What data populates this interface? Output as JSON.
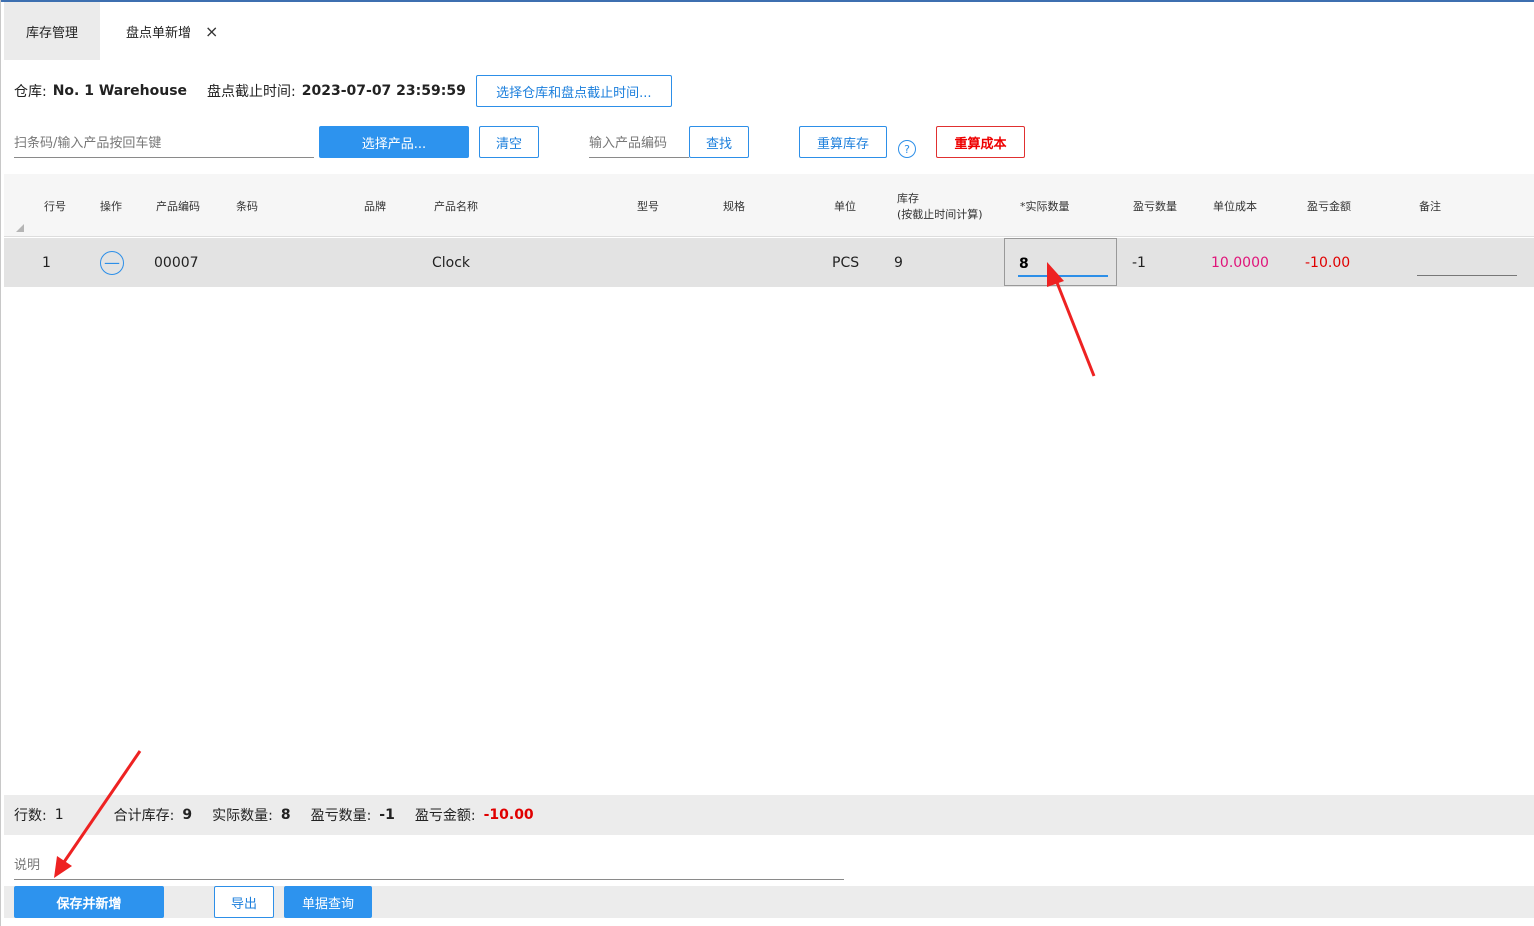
{
  "tabs": [
    {
      "label": "库存管理"
    },
    {
      "label": "盘点单新增",
      "close": "×"
    }
  ],
  "header": {
    "warehouse_label": "仓库:",
    "warehouse_value": "No. 1 Warehouse",
    "cutoff_label": "盘点截止时间:",
    "cutoff_value": "2023-07-07 23:59:59",
    "select_button": "选择仓库和盘点截止时间..."
  },
  "toolbar": {
    "scan_placeholder": "扫条码/输入产品按回车键",
    "select_product": "选择产品...",
    "clear": "清空",
    "code_placeholder": "输入产品编码",
    "find": "查找",
    "recalc_stock": "重算库存",
    "help": "?",
    "recalc_cost": "重算成本"
  },
  "table": {
    "headers": {
      "line": "行号",
      "op": "操作",
      "code": "产品编码",
      "barcode": "条码",
      "brand": "品牌",
      "name": "产品名称",
      "model": "型号",
      "spec": "规格",
      "unit": "单位",
      "stock_line1": "库存",
      "stock_line2": "(按截止时间计算)",
      "actual": "*实际数量",
      "diff_qty": "盈亏数量",
      "unit_cost": "单位成本",
      "diff_amount": "盈亏金额",
      "remark": "备注"
    },
    "rows": [
      {
        "line": "1",
        "op_icon": "minus-circle-icon",
        "code": "00007",
        "barcode": "",
        "brand": "",
        "name": "Clock",
        "model": "",
        "spec": "",
        "unit": "PCS",
        "stock": "9",
        "actual": "8",
        "diff_qty": "-1",
        "unit_cost": "10.0000",
        "diff_amount": "-10.00",
        "remark": ""
      }
    ]
  },
  "summary": {
    "rows_label": "行数:",
    "rows_value": "1",
    "stock_label": "合计库存:",
    "stock_value": "9",
    "actual_label": "实际数量:",
    "actual_value": "8",
    "diff_qty_label": "盈亏数量:",
    "diff_qty_value": "-1",
    "diff_amount_label": "盈亏金额:",
    "diff_amount_value": "-10.00"
  },
  "description_placeholder": "说明",
  "actions": {
    "save_new": "保存并新增",
    "export": "导出",
    "query": "单据查询"
  },
  "colors": {
    "accent": "#2d93ee",
    "cost": "#e0147a",
    "negative": "#e00000",
    "annotation_arrow": "#ee2222"
  }
}
